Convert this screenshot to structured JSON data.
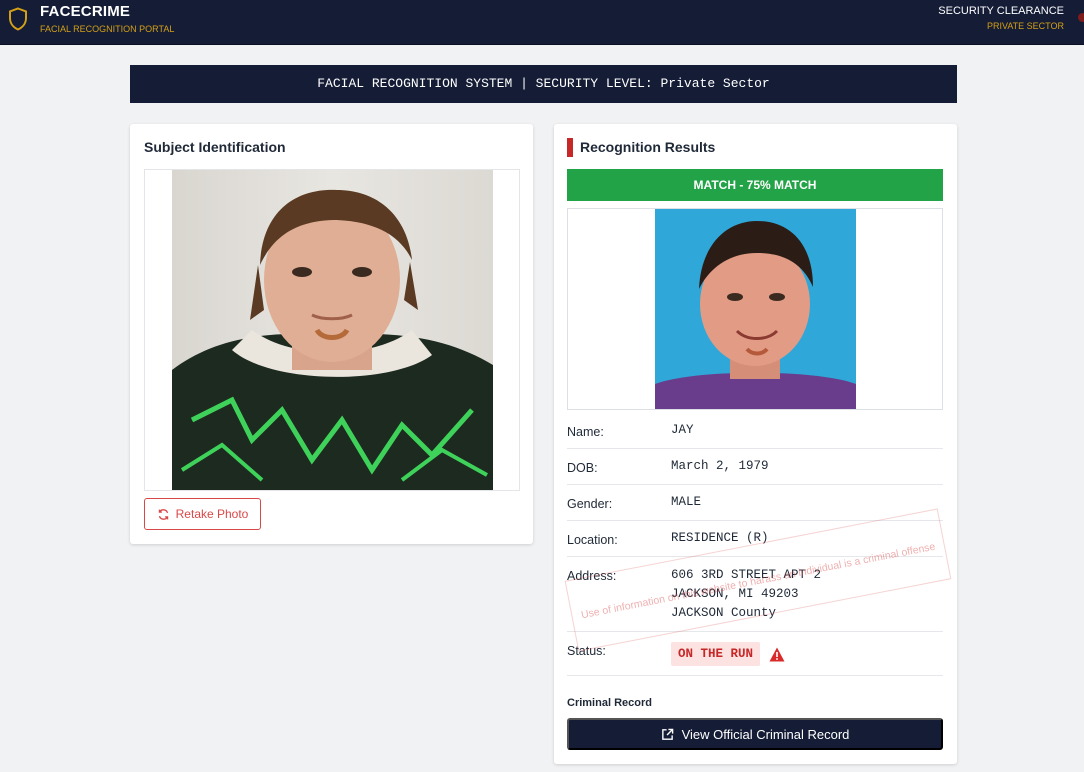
{
  "header": {
    "brand_title": "FACECRIME",
    "brand_subtitle": "FACIAL RECOGNITION PORTAL",
    "clearance_title": "SECURITY CLEARANCE",
    "clearance_value": "PRIVATE SECTOR"
  },
  "banner": {
    "text": "FACIAL RECOGNITION SYSTEM | SECURITY LEVEL: Private Sector"
  },
  "subject": {
    "title": "Subject Identification",
    "retake_label": "Retake Photo"
  },
  "results": {
    "title": "Recognition Results",
    "match_text": "MATCH - 75% MATCH",
    "name_label": "Name:",
    "name_value": "JAY",
    "dob_label": "DOB:",
    "dob_value": "March 2, 1979",
    "gender_label": "Gender:",
    "gender_value": "MALE",
    "location_label": "Location:",
    "location_value": "RESIDENCE (R)",
    "address_label": "Address:",
    "address_line1": "606 3RD STREET APT 2",
    "address_line2": "JACKSON, MI 49203",
    "address_line3": "JACKSON County",
    "status_label": "Status:",
    "status_value": "ON THE RUN",
    "watermark_text": "Use of information on this website to harass an individual is a criminal offense",
    "criminal_record_label": "Criminal Record",
    "view_record_label": "View Official Criminal Record"
  },
  "colors": {
    "navy": "#141c36",
    "gold": "#d4a017",
    "match_green": "#23a347",
    "alert_red": "#c62828"
  },
  "icons": {
    "logo": "shield-icon",
    "retake": "refresh-icon",
    "status": "warning-triangle-icon",
    "view_record": "external-link-icon"
  }
}
